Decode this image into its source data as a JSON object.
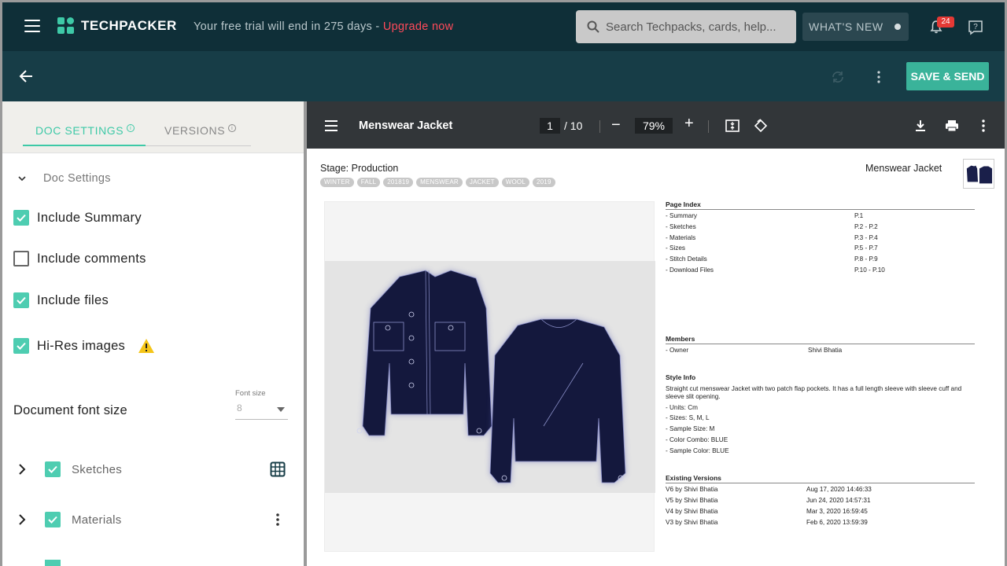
{
  "topbar": {
    "logo_text": "TECHPACKER",
    "trial_text": "Your free trial will end in 275 days",
    "trial_sep": " - ",
    "upgrade_label": "Upgrade now",
    "search_placeholder": "Search Techpacks, cards, help...",
    "whats_new_label": "WHAT'S NEW",
    "notification_count": "24"
  },
  "subbar": {
    "save_send_label": "SAVE & SEND"
  },
  "left_panel": {
    "tabs": [
      {
        "label": "DOC SETTINGS",
        "active": true
      },
      {
        "label": "VERSIONS",
        "active": false
      }
    ],
    "section_title": "Doc Settings",
    "options": [
      {
        "label": "Include Summary",
        "checked": true
      },
      {
        "label": "Include comments",
        "checked": false
      },
      {
        "label": "Include files",
        "checked": true
      },
      {
        "label": "Hi-Res images",
        "checked": true,
        "warning": true
      }
    ],
    "font_size": {
      "label": "Document font size",
      "select_label": "Font size",
      "value": "8"
    },
    "groups": [
      {
        "label": "Sketches",
        "checked": true,
        "icon": "grid-icon"
      },
      {
        "label": "Materials",
        "checked": true,
        "icon": "more-vert-icon"
      }
    ]
  },
  "viewer": {
    "title": "Menswear Jacket",
    "current_page": "1",
    "total_pages": "/ 10",
    "zoom": "79%",
    "minus": "−",
    "plus": "+"
  },
  "document": {
    "stage": "Stage: Production",
    "tags": [
      "WINTER",
      "FALL",
      "201819",
      "MENSWEAR",
      "JACKET",
      "WOOL",
      "2019"
    ],
    "title": "Menswear Jacket",
    "page_index": {
      "heading": "Page Index",
      "rows": [
        {
          "name": "- Summary",
          "page": "P.1"
        },
        {
          "name": "- Sketches",
          "page": "P.2 - P.2"
        },
        {
          "name": "- Materials",
          "page": "P.3 - P.4"
        },
        {
          "name": "- Sizes",
          "page": "P.5 - P.7"
        },
        {
          "name": "- Stitch Details",
          "page": "P.8 - P.9"
        },
        {
          "name": "- Download Files",
          "page": "P.10 - P.10"
        }
      ]
    },
    "members": {
      "heading": "Members",
      "rows": [
        {
          "role": "- Owner",
          "name": "Shivi Bhatia"
        }
      ]
    },
    "style_info": {
      "heading": "Style Info",
      "description": "Straight cut menswear Jacket with two patch flap pockets. It has a full length sleeve with sleeve cuff and sleeve slit opening.",
      "items": [
        "- Units: Cm",
        "- Sizes: S, M, L",
        "- Sample Size: M",
        "- Color Combo: BLUE",
        "- Sample Color: BLUE"
      ]
    },
    "versions": {
      "heading": "Existing Versions",
      "rows": [
        {
          "name": "V6 by Shivi Bhatia",
          "date": "Aug 17, 2020 14:46:33"
        },
        {
          "name": "V5 by Shivi Bhatia",
          "date": "Jun 24, 2020 14:57:31"
        },
        {
          "name": "V4 by Shivi Bhatia",
          "date": "Mar 3, 2020 16:59:45"
        },
        {
          "name": "V3 by Shivi Bhatia",
          "date": "Feb 6, 2020 13:59:39"
        }
      ]
    }
  },
  "colors": {
    "topbar": "#0f2f38",
    "subbar": "#173d47",
    "accent": "#3ec9a7",
    "upgrade": "#ff4a5a",
    "viewer_bar": "#323639",
    "jacket": "#1a1f4a"
  }
}
